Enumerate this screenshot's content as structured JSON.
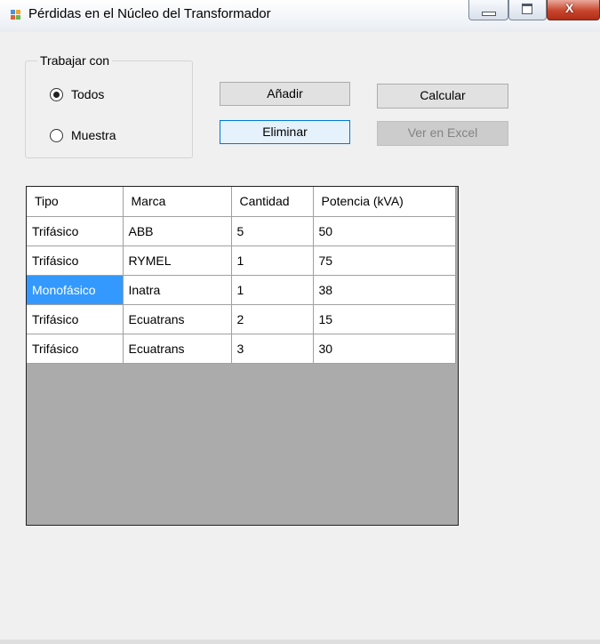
{
  "window": {
    "title": "Pérdidas en el Núcleo del Transformador",
    "close_glyph": "X"
  },
  "group": {
    "legend": "Trabajar con",
    "options": [
      {
        "label": "Todos",
        "selected": true
      },
      {
        "label": "Muestra",
        "selected": false
      }
    ]
  },
  "buttons": {
    "add": "Añadir",
    "delete": "Eliminar",
    "calculate": "Calcular",
    "excel": "Ver en Excel"
  },
  "table": {
    "columns": [
      "Tipo",
      "Marca",
      "Cantidad",
      "Potencia (kVA)"
    ],
    "rows": [
      [
        "Trifásico",
        "ABB",
        "5",
        "50"
      ],
      [
        "Trifásico",
        "RYMEL",
        "1",
        "75"
      ],
      [
        "Monofásico",
        "Inatra",
        "1",
        "38"
      ],
      [
        "Trifásico",
        "Ecuatrans",
        "2",
        "15"
      ],
      [
        "Trifásico",
        "Ecuatrans",
        "3",
        "30"
      ]
    ],
    "selected_cell": {
      "row": 2,
      "col": 0
    },
    "selection_color": "#3399ff"
  }
}
